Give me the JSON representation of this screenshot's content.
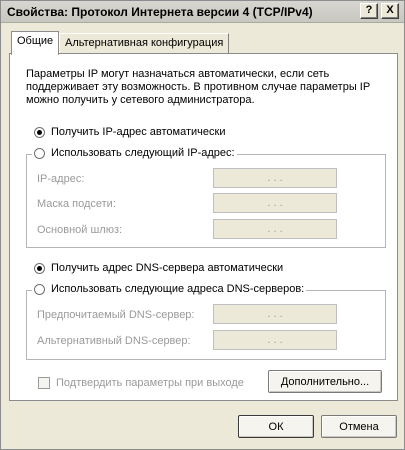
{
  "window": {
    "title": "Свойства: Протокол Интернета версии 4 (TCP/IPv4)",
    "help_label": "?",
    "close_label": "X"
  },
  "tabs": [
    {
      "label": "Общие",
      "active": true
    },
    {
      "label": "Альтернативная конфигурация",
      "active": false
    }
  ],
  "description": "Параметры IP могут назначаться автоматически, если сеть поддерживает эту возможность. В противном случае параметры IP можно получить у сетевого администратора.",
  "ip": {
    "auto_label": "Получить IP-адрес автоматически",
    "auto_checked": true,
    "manual_label": "Использовать следующий IP-адрес:",
    "fields": [
      {
        "label": "IP-адрес:",
        "value": ". . ."
      },
      {
        "label": "Маска подсети:",
        "value": ". . ."
      },
      {
        "label": "Основной шлюз:",
        "value": ". . ."
      }
    ]
  },
  "dns": {
    "auto_label": "Получить адрес DNS-сервера автоматически",
    "auto_checked": true,
    "manual_label": "Использовать следующие адреса DNS-серверов:",
    "fields": [
      {
        "label": "Предпочитаемый DNS-сервер:",
        "value": ". . ."
      },
      {
        "label": "Альтернативный DNS-сервер:",
        "value": ". . ."
      }
    ]
  },
  "validate_label": "Подтвердить параметры при выходе",
  "advanced_label": "Дополнительно...",
  "ok_label": "ОК",
  "cancel_label": "Отмена"
}
